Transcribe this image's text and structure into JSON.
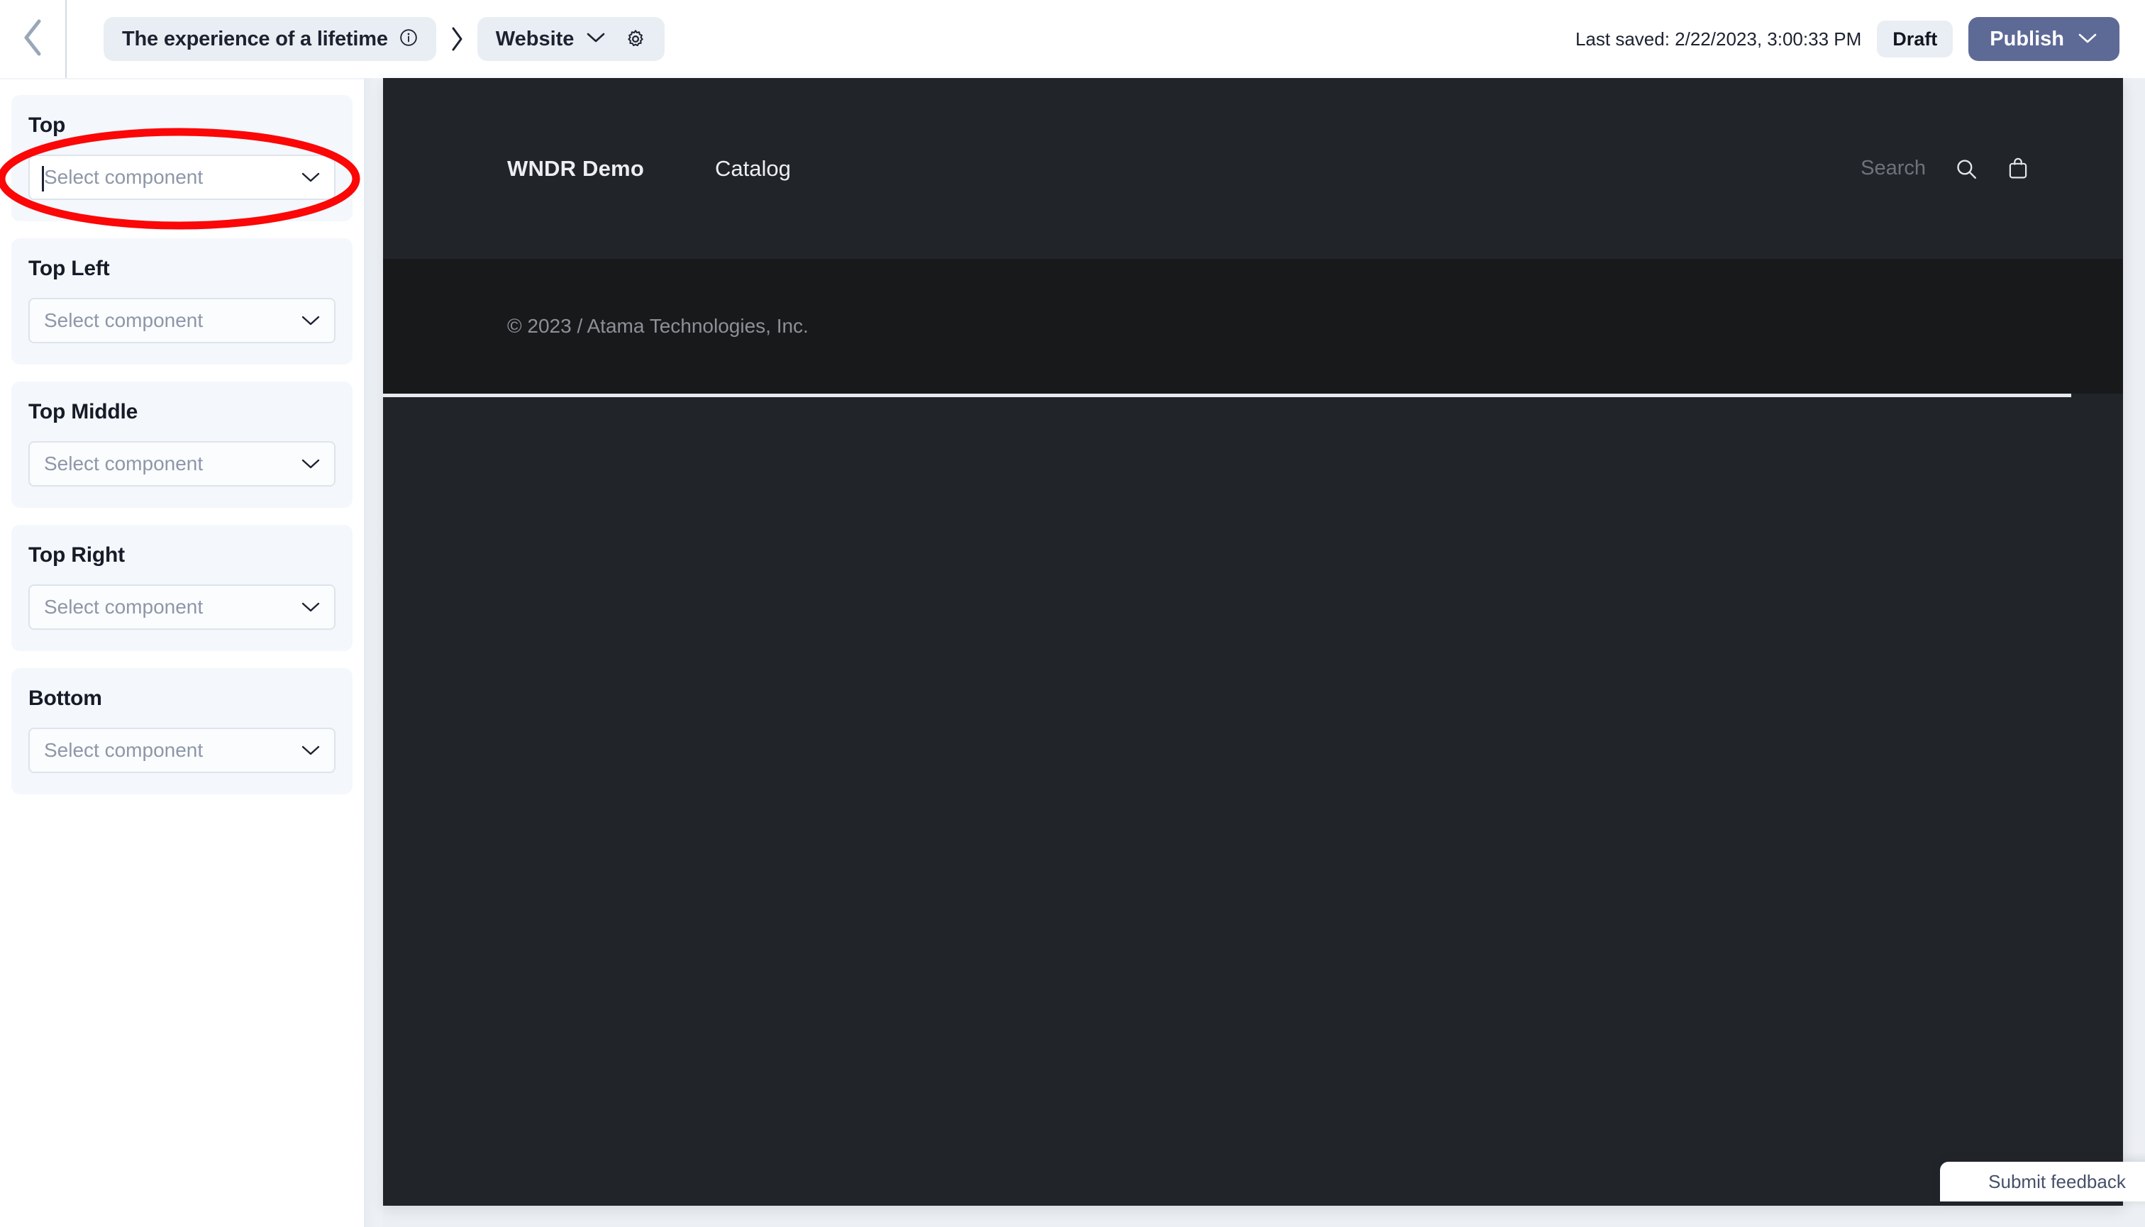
{
  "header": {
    "back_icon": "chevron-left-icon",
    "breadcrumb": {
      "page_title": "The experience of a lifetime",
      "info_icon": "info-circle-icon",
      "separator_icon": "chevron-right-icon",
      "scope_label": "Website",
      "scope_caret_icon": "chevron-down-icon",
      "settings_icon": "gear-icon"
    },
    "last_saved": "Last saved: 2/22/2023, 3:00:33 PM",
    "status_badge": "Draft",
    "publish_label": "Publish",
    "publish_caret_icon": "chevron-down-icon",
    "publish_color": "#5e6a96"
  },
  "sidebar": {
    "sections": [
      {
        "label": "Top",
        "placeholder": "Select component",
        "focused": true,
        "caret_icon": "chevron-down-icon"
      },
      {
        "label": "Top Left",
        "placeholder": "Select component",
        "focused": false,
        "caret_icon": "chevron-down-icon"
      },
      {
        "label": "Top Middle",
        "placeholder": "Select component",
        "focused": false,
        "caret_icon": "chevron-down-icon"
      },
      {
        "label": "Top Right",
        "placeholder": "Select component",
        "focused": false,
        "caret_icon": "chevron-down-icon"
      },
      {
        "label": "Bottom",
        "placeholder": "Select component",
        "focused": false,
        "caret_icon": "chevron-down-icon"
      }
    ]
  },
  "preview": {
    "brand": "WNDR Demo",
    "nav_link": "Catalog",
    "search_placeholder": "Search",
    "search_icon": "search-icon",
    "cart_icon": "shopping-bag-icon",
    "footer_copyright": "© 2023 / Atama Technologies, Inc.",
    "background_color": "#212429",
    "footer_color": "#18191b"
  },
  "feedback": {
    "label": "Submit feedback"
  },
  "annotation": {
    "shape": "ellipse",
    "color": "#fb0707",
    "target": "Top section component selector"
  }
}
